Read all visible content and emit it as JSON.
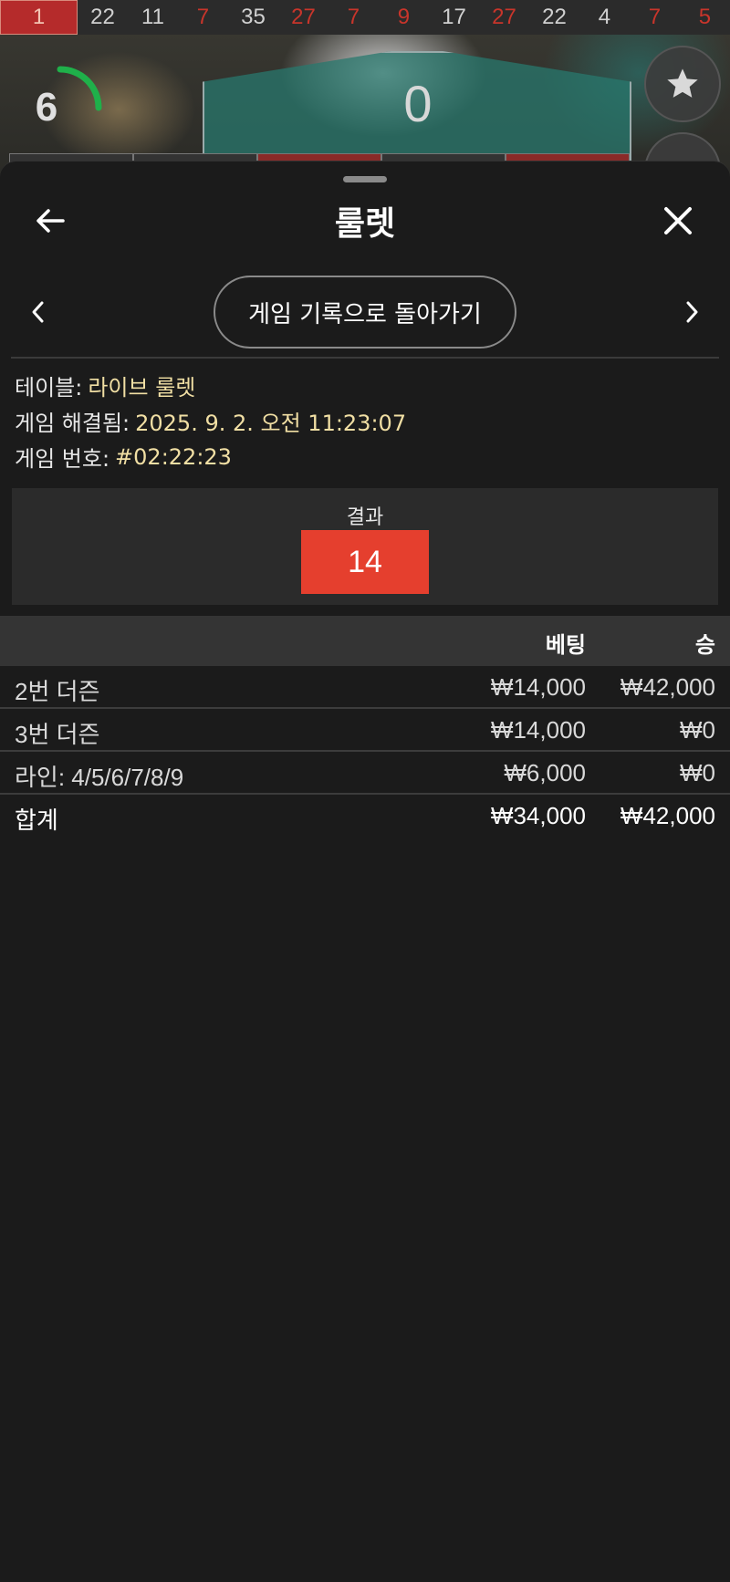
{
  "history": {
    "numbers": [
      {
        "value": "1",
        "color": "first"
      },
      {
        "value": "22",
        "color": "black"
      },
      {
        "value": "11",
        "color": "black"
      },
      {
        "value": "7",
        "color": "red"
      },
      {
        "value": "35",
        "color": "black"
      },
      {
        "value": "27",
        "color": "red"
      },
      {
        "value": "7",
        "color": "red"
      },
      {
        "value": "9",
        "color": "red"
      },
      {
        "value": "17",
        "color": "black"
      },
      {
        "value": "27",
        "color": "red"
      },
      {
        "value": "22",
        "color": "black"
      },
      {
        "value": "4",
        "color": "black"
      },
      {
        "value": "7",
        "color": "red"
      },
      {
        "value": "5",
        "color": "red"
      }
    ]
  },
  "game": {
    "timer": "6",
    "zero_label": "0",
    "favorite_icon": "star-icon"
  },
  "sheet": {
    "title": "룰렛",
    "back_icon": "arrow-left-icon",
    "close_icon": "close-icon",
    "back_to_history_label": "게임 기록으로 돌아가기",
    "prev_icon": "chevron-left-icon",
    "next_icon": "chevron-right-icon"
  },
  "info": {
    "table_label": "테이블:",
    "table_value": "라이브 룰렛",
    "resolved_label": "게임 해결됨:",
    "resolved_value": "2025. 9. 2. 오전 11:23:07",
    "game_number_label": "게임 번호:",
    "game_number_value": "#02:22:23"
  },
  "result": {
    "label": "결과",
    "number": "14",
    "number_color": "#e53f2e"
  },
  "bets": {
    "headers": {
      "name": "",
      "bet": "베팅",
      "win": "승"
    },
    "rows": [
      {
        "name": "2번 더즌",
        "bet": "₩14,000",
        "win": "₩42,000"
      },
      {
        "name": "3번 더즌",
        "bet": "₩14,000",
        "win": "₩0"
      },
      {
        "name": "라인: 4/5/6/7/8/9",
        "bet": "₩6,000",
        "win": "₩0"
      }
    ],
    "total": {
      "name": "합계",
      "bet": "₩34,000",
      "win": "₩42,000"
    }
  }
}
